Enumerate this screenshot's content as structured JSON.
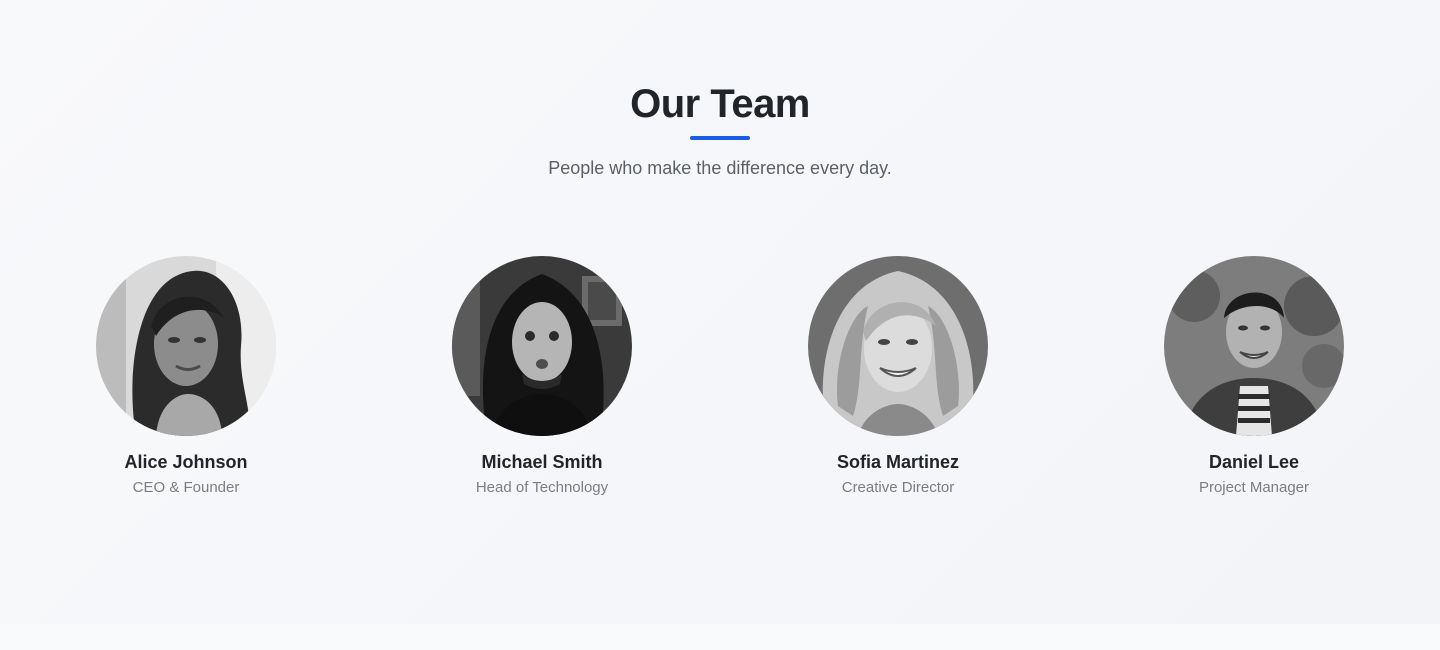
{
  "section": {
    "title": "Our Team",
    "subtitle": "People who make the difference every day.",
    "accent_color": "#1a5ce5"
  },
  "members": [
    {
      "name": "Alice Johnson",
      "role": "CEO & Founder",
      "photo": "grayscale portrait, woman with long dark wavy hair"
    },
    {
      "name": "Michael Smith",
      "role": "Head of Technology",
      "photo": "grayscale portrait, man with long dreadlocks and dark t-shirt"
    },
    {
      "name": "Sofia Martinez",
      "role": "Creative Director",
      "photo": "grayscale portrait, smiling woman with wavy blonde hair"
    },
    {
      "name": "Daniel Lee",
      "role": "Project Manager",
      "photo": "grayscale portrait, smiling man in jacket and striped shirt"
    }
  ]
}
